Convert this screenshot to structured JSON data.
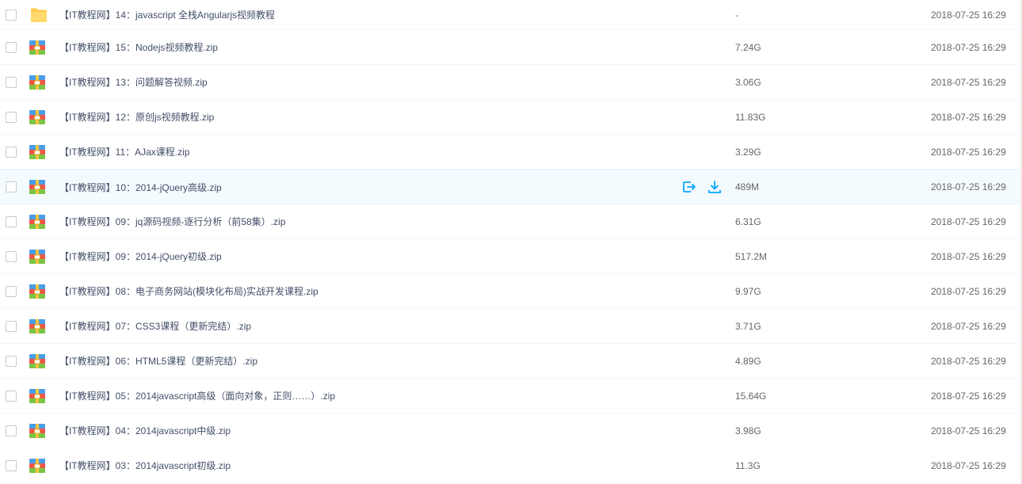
{
  "files": [
    {
      "name": "【IT教程网】14：javascript 全栈Angularjs视频教程",
      "type": "folder",
      "size": "-",
      "date": "2018-07-25 16:29"
    },
    {
      "name": "【IT教程网】15：Nodejs视频教程.zip",
      "type": "zip",
      "size": "7.24G",
      "date": "2018-07-25 16:29"
    },
    {
      "name": "【IT教程网】13：问题解答视频.zip",
      "type": "zip",
      "size": "3.06G",
      "date": "2018-07-25 16:29"
    },
    {
      "name": "【IT教程网】12：原创js视频教程.zip",
      "type": "zip",
      "size": "11.83G",
      "date": "2018-07-25 16:29"
    },
    {
      "name": "【IT教程网】11：AJax课程.zip",
      "type": "zip",
      "size": "3.29G",
      "date": "2018-07-25 16:29"
    },
    {
      "name": "【IT教程网】10：2014-jQuery高级.zip",
      "type": "zip",
      "size": "489M",
      "date": "2018-07-25 16:29",
      "hover": true
    },
    {
      "name": "【IT教程网】09：jq源码视频-逐行分析（前58集）.zip",
      "type": "zip",
      "size": "6.31G",
      "date": "2018-07-25 16:29"
    },
    {
      "name": "【IT教程网】09：2014-jQuery初级.zip",
      "type": "zip",
      "size": "517.2M",
      "date": "2018-07-25 16:29"
    },
    {
      "name": "【IT教程网】08：电子商务网站(模块化布局)实战开发课程.zip",
      "type": "zip",
      "size": "9.97G",
      "date": "2018-07-25 16:29"
    },
    {
      "name": "【IT教程网】07：CSS3课程（更新完结）.zip",
      "type": "zip",
      "size": "3.71G",
      "date": "2018-07-25 16:29"
    },
    {
      "name": "【IT教程网】06：HTML5课程（更新完结）.zip",
      "type": "zip",
      "size": "4.89G",
      "date": "2018-07-25 16:29"
    },
    {
      "name": "【IT教程网】05：2014javascript高级（面向对象，正则……）.zip",
      "type": "zip",
      "size": "15.64G",
      "date": "2018-07-25 16:29"
    },
    {
      "name": "【IT教程网】04：2014javascript中级.zip",
      "type": "zip",
      "size": "3.98G",
      "date": "2018-07-25 16:29"
    },
    {
      "name": "【IT教程网】03：2014javascript初级.zip",
      "type": "zip",
      "size": "11.3G",
      "date": "2018-07-25 16:29"
    }
  ],
  "row_actions": {
    "share_icon": "share-icon",
    "download_icon": "download-icon"
  },
  "colors": {
    "accent": "#06a7ff",
    "folder": "#ffd36b",
    "hover_bg": "#f4fbff"
  }
}
